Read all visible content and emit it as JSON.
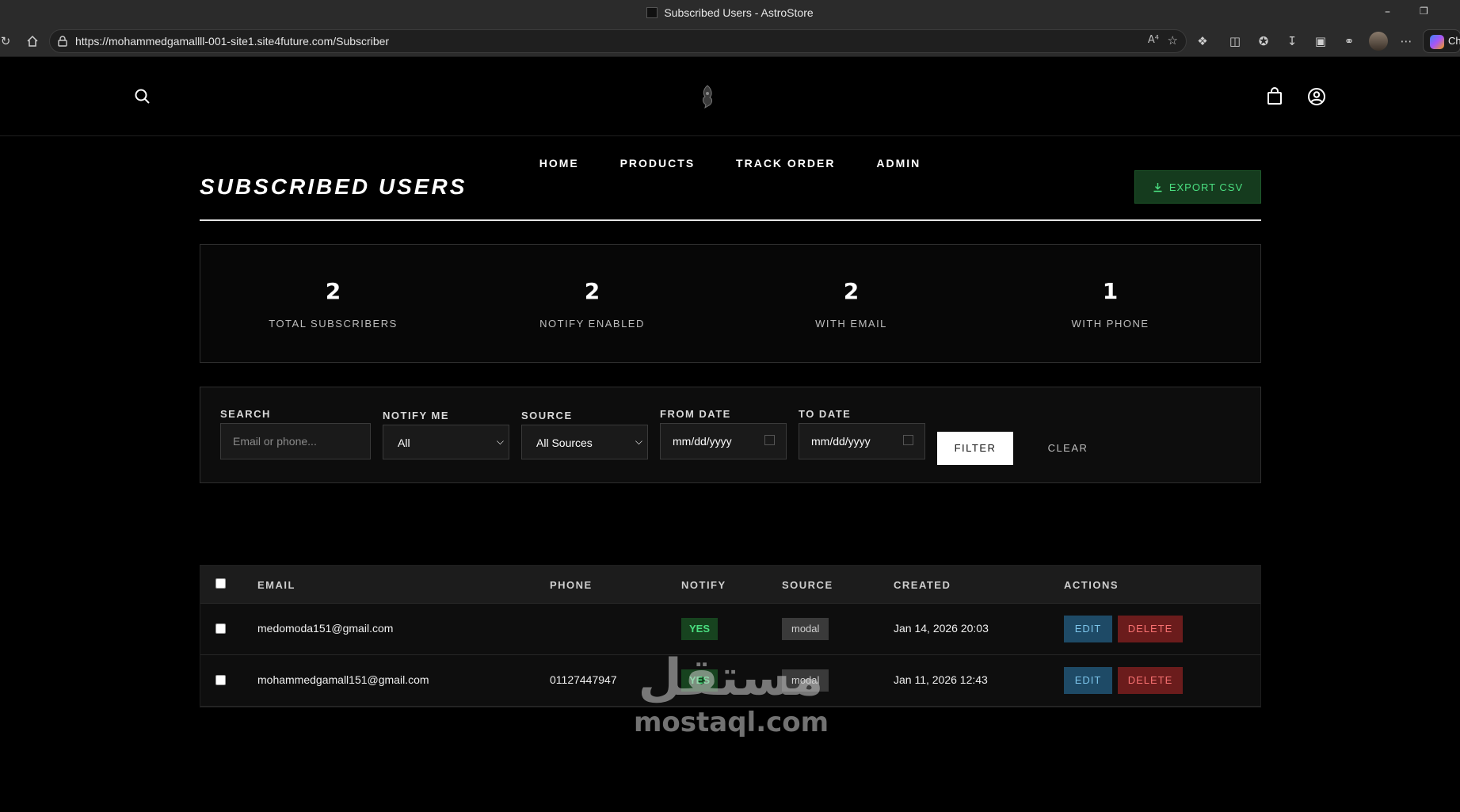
{
  "browser": {
    "window_title": "Subscribed Users - AstroStore",
    "url": "https://mohammedgamallll-001-site1.site4future.com/Subscriber",
    "read_aloud_label": "A⁴",
    "copilot_label": "Ch"
  },
  "header": {
    "nav": [
      {
        "label": "HOME"
      },
      {
        "label": "PRODUCTS"
      },
      {
        "label": "TRACK ORDER"
      },
      {
        "label": "ADMIN"
      }
    ]
  },
  "page": {
    "title": "SUBSCRIBED USERS",
    "export_label": "EXPORT CSV"
  },
  "stats": [
    {
      "value": "2",
      "label": "TOTAL SUBSCRIBERS"
    },
    {
      "value": "2",
      "label": "NOTIFY ENABLED"
    },
    {
      "value": "2",
      "label": "WITH EMAIL"
    },
    {
      "value": "1",
      "label": "WITH PHONE"
    }
  ],
  "filters": {
    "search_label": "SEARCH",
    "search_placeholder": "Email or phone...",
    "notify_label": "NOTIFY ME",
    "notify_value": "All",
    "source_label": "SOURCE",
    "source_value": "All Sources",
    "from_label": "FROM DATE",
    "from_value": "mm/dd/yyyy",
    "to_label": "TO DATE",
    "to_value": "mm/dd/yyyy",
    "filter_button": "FILTER",
    "clear_button": "CLEAR"
  },
  "table": {
    "columns": [
      "EMAIL",
      "PHONE",
      "NOTIFY",
      "SOURCE",
      "CREATED",
      "ACTIONS"
    ],
    "rows": [
      {
        "email": "medomoda151@gmail.com",
        "phone": "",
        "notify": "YES",
        "source": "modal",
        "created": "Jan 14, 2026 20:03",
        "edit": "EDIT",
        "delete": "DELETE"
      },
      {
        "email": "mohammedgamall151@gmail.com",
        "phone": "01127447947",
        "notify": "YES",
        "source": "modal",
        "created": "Jan 11, 2026 12:43",
        "edit": "EDIT",
        "delete": "DELETE"
      }
    ]
  },
  "watermark": {
    "arabic": "مستقل",
    "latin": "mostaql.com"
  },
  "colors": {
    "background": "#000000",
    "export_green": "#4ade80",
    "edit_blue": "#1e4a66",
    "delete_red": "#6b1c1c"
  }
}
